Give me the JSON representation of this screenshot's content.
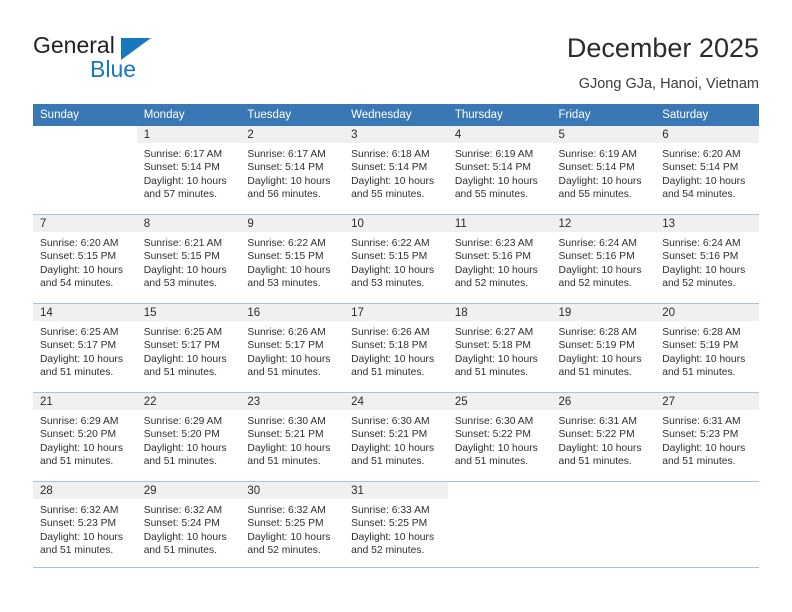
{
  "brand": {
    "name_part1": "General",
    "name_part2": "Blue",
    "triangle_icon": "triangle-icon",
    "accent_color": "#1878be"
  },
  "header": {
    "title": "December 2025",
    "location": "GJong GJa, Hanoi, Vietnam",
    "header_bg_color": "#3a78b5",
    "daynum_band_color": "#f0f0f0"
  },
  "weekdays": [
    "Sunday",
    "Monday",
    "Tuesday",
    "Wednesday",
    "Thursday",
    "Friday",
    "Saturday"
  ],
  "weeks": [
    [
      {
        "day": "",
        "sunrise": "",
        "sunset": "",
        "daylight1": "",
        "daylight2": ""
      },
      {
        "day": "1",
        "sunrise": "Sunrise: 6:17 AM",
        "sunset": "Sunset: 5:14 PM",
        "daylight1": "Daylight: 10 hours",
        "daylight2": "and 57 minutes."
      },
      {
        "day": "2",
        "sunrise": "Sunrise: 6:17 AM",
        "sunset": "Sunset: 5:14 PM",
        "daylight1": "Daylight: 10 hours",
        "daylight2": "and 56 minutes."
      },
      {
        "day": "3",
        "sunrise": "Sunrise: 6:18 AM",
        "sunset": "Sunset: 5:14 PM",
        "daylight1": "Daylight: 10 hours",
        "daylight2": "and 55 minutes."
      },
      {
        "day": "4",
        "sunrise": "Sunrise: 6:19 AM",
        "sunset": "Sunset: 5:14 PM",
        "daylight1": "Daylight: 10 hours",
        "daylight2": "and 55 minutes."
      },
      {
        "day": "5",
        "sunrise": "Sunrise: 6:19 AM",
        "sunset": "Sunset: 5:14 PM",
        "daylight1": "Daylight: 10 hours",
        "daylight2": "and 55 minutes."
      },
      {
        "day": "6",
        "sunrise": "Sunrise: 6:20 AM",
        "sunset": "Sunset: 5:14 PM",
        "daylight1": "Daylight: 10 hours",
        "daylight2": "and 54 minutes."
      }
    ],
    [
      {
        "day": "7",
        "sunrise": "Sunrise: 6:20 AM",
        "sunset": "Sunset: 5:15 PM",
        "daylight1": "Daylight: 10 hours",
        "daylight2": "and 54 minutes."
      },
      {
        "day": "8",
        "sunrise": "Sunrise: 6:21 AM",
        "sunset": "Sunset: 5:15 PM",
        "daylight1": "Daylight: 10 hours",
        "daylight2": "and 53 minutes."
      },
      {
        "day": "9",
        "sunrise": "Sunrise: 6:22 AM",
        "sunset": "Sunset: 5:15 PM",
        "daylight1": "Daylight: 10 hours",
        "daylight2": "and 53 minutes."
      },
      {
        "day": "10",
        "sunrise": "Sunrise: 6:22 AM",
        "sunset": "Sunset: 5:15 PM",
        "daylight1": "Daylight: 10 hours",
        "daylight2": "and 53 minutes."
      },
      {
        "day": "11",
        "sunrise": "Sunrise: 6:23 AM",
        "sunset": "Sunset: 5:16 PM",
        "daylight1": "Daylight: 10 hours",
        "daylight2": "and 52 minutes."
      },
      {
        "day": "12",
        "sunrise": "Sunrise: 6:24 AM",
        "sunset": "Sunset: 5:16 PM",
        "daylight1": "Daylight: 10 hours",
        "daylight2": "and 52 minutes."
      },
      {
        "day": "13",
        "sunrise": "Sunrise: 6:24 AM",
        "sunset": "Sunset: 5:16 PM",
        "daylight1": "Daylight: 10 hours",
        "daylight2": "and 52 minutes."
      }
    ],
    [
      {
        "day": "14",
        "sunrise": "Sunrise: 6:25 AM",
        "sunset": "Sunset: 5:17 PM",
        "daylight1": "Daylight: 10 hours",
        "daylight2": "and 51 minutes."
      },
      {
        "day": "15",
        "sunrise": "Sunrise: 6:25 AM",
        "sunset": "Sunset: 5:17 PM",
        "daylight1": "Daylight: 10 hours",
        "daylight2": "and 51 minutes."
      },
      {
        "day": "16",
        "sunrise": "Sunrise: 6:26 AM",
        "sunset": "Sunset: 5:17 PM",
        "daylight1": "Daylight: 10 hours",
        "daylight2": "and 51 minutes."
      },
      {
        "day": "17",
        "sunrise": "Sunrise: 6:26 AM",
        "sunset": "Sunset: 5:18 PM",
        "daylight1": "Daylight: 10 hours",
        "daylight2": "and 51 minutes."
      },
      {
        "day": "18",
        "sunrise": "Sunrise: 6:27 AM",
        "sunset": "Sunset: 5:18 PM",
        "daylight1": "Daylight: 10 hours",
        "daylight2": "and 51 minutes."
      },
      {
        "day": "19",
        "sunrise": "Sunrise: 6:28 AM",
        "sunset": "Sunset: 5:19 PM",
        "daylight1": "Daylight: 10 hours",
        "daylight2": "and 51 minutes."
      },
      {
        "day": "20",
        "sunrise": "Sunrise: 6:28 AM",
        "sunset": "Sunset: 5:19 PM",
        "daylight1": "Daylight: 10 hours",
        "daylight2": "and 51 minutes."
      }
    ],
    [
      {
        "day": "21",
        "sunrise": "Sunrise: 6:29 AM",
        "sunset": "Sunset: 5:20 PM",
        "daylight1": "Daylight: 10 hours",
        "daylight2": "and 51 minutes."
      },
      {
        "day": "22",
        "sunrise": "Sunrise: 6:29 AM",
        "sunset": "Sunset: 5:20 PM",
        "daylight1": "Daylight: 10 hours",
        "daylight2": "and 51 minutes."
      },
      {
        "day": "23",
        "sunrise": "Sunrise: 6:30 AM",
        "sunset": "Sunset: 5:21 PM",
        "daylight1": "Daylight: 10 hours",
        "daylight2": "and 51 minutes."
      },
      {
        "day": "24",
        "sunrise": "Sunrise: 6:30 AM",
        "sunset": "Sunset: 5:21 PM",
        "daylight1": "Daylight: 10 hours",
        "daylight2": "and 51 minutes."
      },
      {
        "day": "25",
        "sunrise": "Sunrise: 6:30 AM",
        "sunset": "Sunset: 5:22 PM",
        "daylight1": "Daylight: 10 hours",
        "daylight2": "and 51 minutes."
      },
      {
        "day": "26",
        "sunrise": "Sunrise: 6:31 AM",
        "sunset": "Sunset: 5:22 PM",
        "daylight1": "Daylight: 10 hours",
        "daylight2": "and 51 minutes."
      },
      {
        "day": "27",
        "sunrise": "Sunrise: 6:31 AM",
        "sunset": "Sunset: 5:23 PM",
        "daylight1": "Daylight: 10 hours",
        "daylight2": "and 51 minutes."
      }
    ],
    [
      {
        "day": "28",
        "sunrise": "Sunrise: 6:32 AM",
        "sunset": "Sunset: 5:23 PM",
        "daylight1": "Daylight: 10 hours",
        "daylight2": "and 51 minutes."
      },
      {
        "day": "29",
        "sunrise": "Sunrise: 6:32 AM",
        "sunset": "Sunset: 5:24 PM",
        "daylight1": "Daylight: 10 hours",
        "daylight2": "and 51 minutes."
      },
      {
        "day": "30",
        "sunrise": "Sunrise: 6:32 AM",
        "sunset": "Sunset: 5:25 PM",
        "daylight1": "Daylight: 10 hours",
        "daylight2": "and 52 minutes."
      },
      {
        "day": "31",
        "sunrise": "Sunrise: 6:33 AM",
        "sunset": "Sunset: 5:25 PM",
        "daylight1": "Daylight: 10 hours",
        "daylight2": "and 52 minutes."
      },
      {
        "day": "",
        "sunrise": "",
        "sunset": "",
        "daylight1": "",
        "daylight2": ""
      },
      {
        "day": "",
        "sunrise": "",
        "sunset": "",
        "daylight1": "",
        "daylight2": ""
      },
      {
        "day": "",
        "sunrise": "",
        "sunset": "",
        "daylight1": "",
        "daylight2": ""
      }
    ]
  ]
}
